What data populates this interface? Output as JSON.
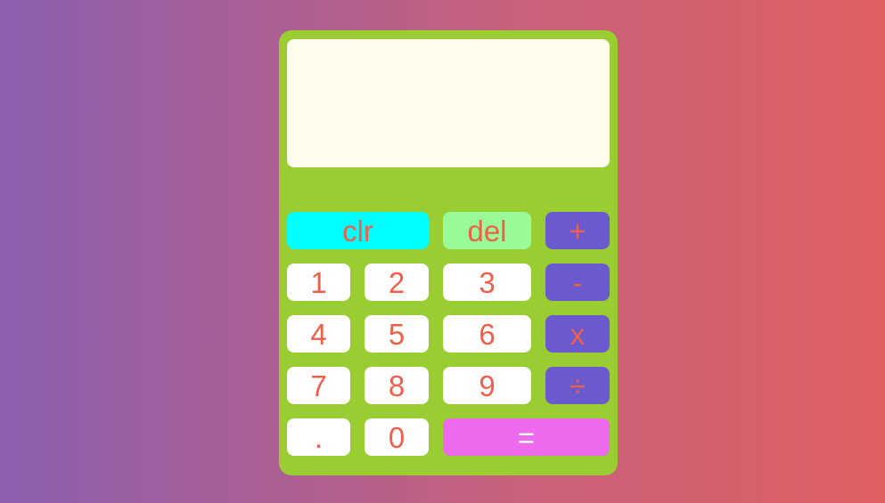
{
  "display": {
    "value": ""
  },
  "keys": {
    "clear": "clr",
    "delete": "del",
    "plus": "+",
    "minus": "-",
    "multiply": "x",
    "divide": "÷",
    "one": "1",
    "two": "2",
    "three": "3",
    "four": "4",
    "five": "5",
    "six": "6",
    "seven": "7",
    "eight": "8",
    "nine": "9",
    "decimal": ".",
    "zero": "0",
    "equals": "="
  },
  "colors": {
    "body": "#9acd32",
    "display": "#fffeec",
    "digit_key": "#ffffff",
    "clear_key": "#00ffff",
    "delete_key": "#98fb98",
    "operator_key": "#6a5acd",
    "equals_key": "#ee6aed",
    "key_text": "#ef5f4b"
  }
}
